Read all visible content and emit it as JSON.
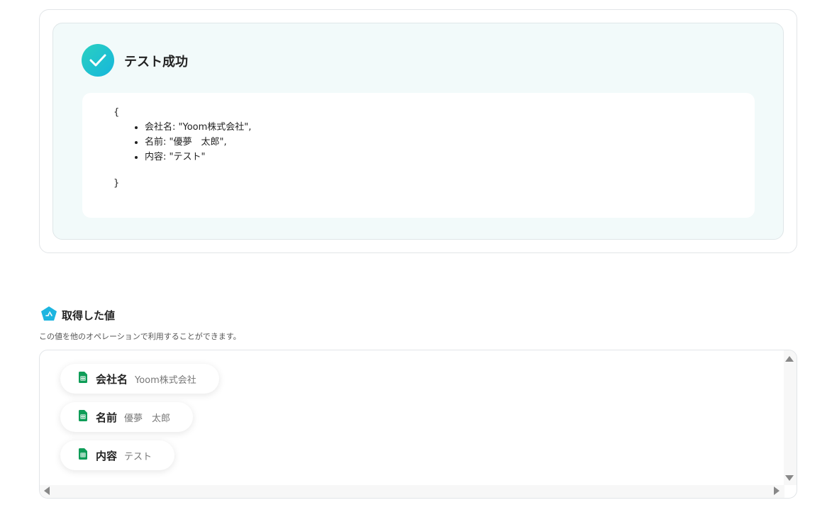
{
  "test_result": {
    "title": "テスト成功",
    "brace_open": "{",
    "brace_close": "}",
    "lines": [
      "会社名: \"Yoom株式会社\",",
      "名前: \"優夢　太郎\",",
      "内容: \"テスト\""
    ]
  },
  "retrieved": {
    "title": "取得した値",
    "description": "この値を他のオペレーションで利用することができます。",
    "items": [
      {
        "key": "会社名",
        "value": "Yoom株式会社"
      },
      {
        "key": "名前",
        "value": "優夢　太郎"
      },
      {
        "key": "内容",
        "value": "テスト"
      }
    ]
  },
  "colors": {
    "success_gradient_start": "#2ad0c0",
    "success_gradient_end": "#16b6dc",
    "sheets_green": "#0f9d58",
    "yoom_badge": "#1cb5e0"
  },
  "icons": {
    "success": "check-circle-icon",
    "section": "yoom-pentagon-icon",
    "field": "google-sheets-icon"
  }
}
